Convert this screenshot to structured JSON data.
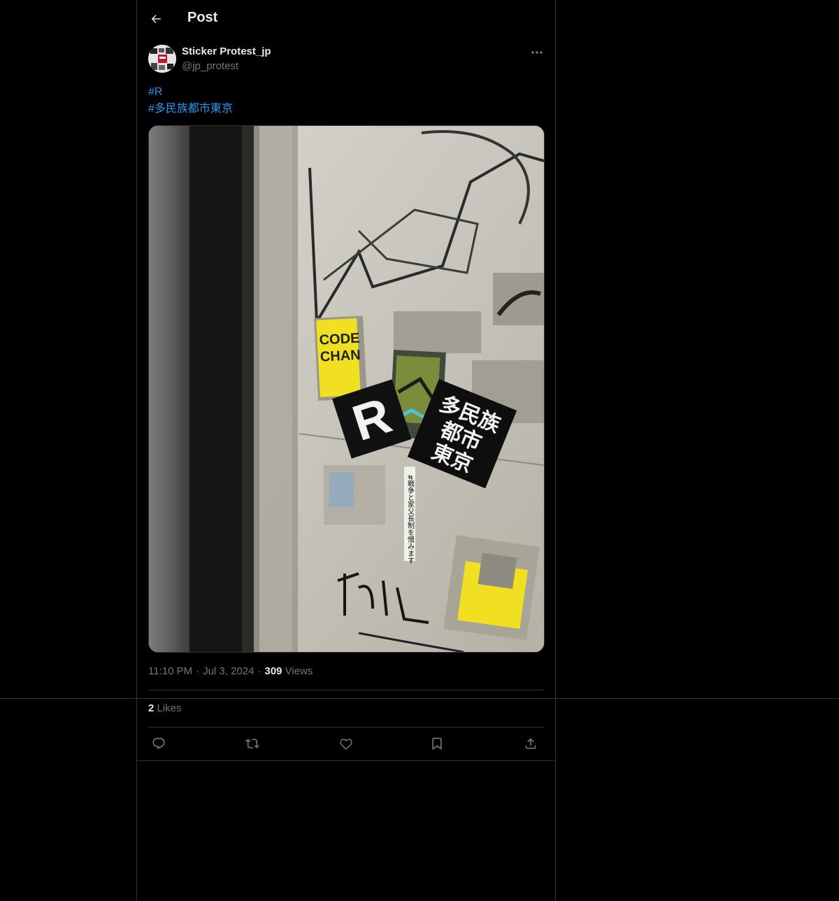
{
  "header": {
    "title": "Post",
    "back_icon": "arrow-left-icon"
  },
  "author": {
    "display_name": "Sticker Protest_jp",
    "handle": "@jp_protest",
    "more_icon": "ellipsis-icon"
  },
  "tweet": {
    "hashtags": [
      "#R",
      "#多民族都市東京"
    ],
    "image_texts": {
      "r_sticker": "R",
      "sticker_jp_lines": [
        "多民族",
        "都市",
        "東京"
      ],
      "sticker_yellow_1": [
        "CODE",
        "CHAN"
      ],
      "small_slip": "#戦争と家父長制を憎みます"
    }
  },
  "meta": {
    "time": "11:10 PM",
    "date": "Jul 3, 2024",
    "views_count": "309",
    "views_label": "Views"
  },
  "stats": {
    "likes_count": "2",
    "likes_label": "Likes"
  },
  "actions": [
    "reply-icon",
    "retweet-icon",
    "like-icon",
    "bookmark-icon",
    "share-icon"
  ],
  "colors": {
    "background": "#000000",
    "text": "#e7e9ea",
    "secondary": "#71767b",
    "border": "#2f3336",
    "link": "#1d9bf0"
  }
}
